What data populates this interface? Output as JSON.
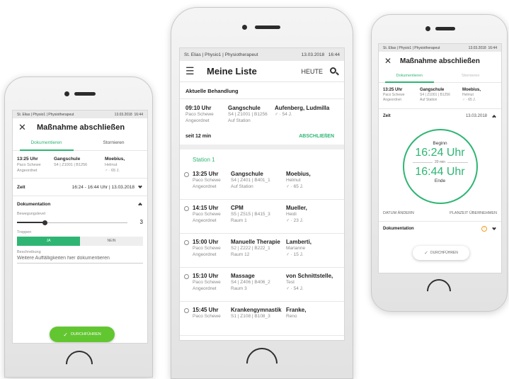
{
  "status": {
    "org": "St. Elias | Physio1 | Physiotherapeut",
    "date": "13.03.2018",
    "time": "16:44"
  },
  "left": {
    "title": "Maßnahme abschließen",
    "tabs": [
      "Dokumentieren",
      "Stornieren"
    ],
    "appointment": {
      "time": "13:25 Uhr",
      "therapist": "Paco Schewe",
      "status": "Angeordnet",
      "treatment": "Gangschule",
      "room_code": "S4 | Z1001 | B1256",
      "patient": "Moebius,",
      "first_name": "Helmut",
      "age": "♂ · 65 J."
    },
    "zeit_label": "Zeit",
    "zeit_value": "16:24 - 16:44 Uhr | 13.03.2018",
    "doc_label": "Dokumentation",
    "slider_label": "Bewegungslevel",
    "slider_value": "3",
    "slider_fraction": 0.25,
    "stairs_label": "Treppen",
    "stairs_yes": "JA",
    "stairs_no": "NEIN",
    "desc_label": "Beschreibung",
    "desc_placeholder": "Weitere Auffälligkeiten hier dokumentieren",
    "action": "DURCHFÜHREN"
  },
  "middle": {
    "title": "Meine Liste",
    "today": "HEUTE",
    "current_header": "Aktuelle Behandlung",
    "current": {
      "time": "09:10 Uhr",
      "therapist": "Paco Schewe",
      "status": "Angeordnet",
      "treatment": "Gangschule",
      "room_code": "S4 | Z1001 | B1256",
      "location": "Auf Station",
      "patient": "Aufenberg, Ludmilla",
      "age": "♂ · 54 J."
    },
    "since": "seit 12 min",
    "finish": "ABSCHLIEßEN",
    "station": "Station 1",
    "items": [
      {
        "time": "13:25 Uhr",
        "therapist": "Paco Schewe",
        "status": "Angeordnet",
        "treatment": "Gangschule",
        "room_code": "S4 | Z401 | B401_1",
        "location": "Auf Station",
        "patient": "Moebius,",
        "first_name": "Helmut",
        "age": "♂ · 65 J."
      },
      {
        "time": "14:15 Uhr",
        "therapist": "Paco Schewe",
        "status": "Angeordnet",
        "treatment": "CPM",
        "room_code": "S5 | Z515 | B415_3",
        "location": "Raum 1",
        "patient": "Mueller,",
        "first_name": "Heidi",
        "age": "♂ · 23 J."
      },
      {
        "time": "15:00 Uhr",
        "therapist": "Paco Schewe",
        "status": "Angeordnet",
        "treatment": "Manuelle Therapie",
        "room_code": "S2 | Z222 | B222_1",
        "location": "Raum 12",
        "patient": "Lamberti,",
        "first_name": "Marianne",
        "age": "♂ · 15 J."
      },
      {
        "time": "15:10 Uhr",
        "therapist": "Paco Schewe",
        "status": "Angeordnet",
        "treatment": "Massage",
        "room_code": "S4 | Z406 | B406_2",
        "location": "Raum 3",
        "patient": "von Schnittstelle,",
        "first_name": "Test",
        "age": "♂ · 54 J."
      },
      {
        "time": "15:45 Uhr",
        "therapist": "Paco Schewe",
        "status": "",
        "treatment": "Krankengymnastik",
        "room_code": "S1 | Z108 | B108_3",
        "location": "",
        "patient": "Franke,",
        "first_name": "Reno",
        "age": ""
      }
    ]
  },
  "right": {
    "title": "Maßnahme abschließen",
    "tabs": [
      "Dokumentieren",
      "Stornieren"
    ],
    "appointment": {
      "time": "13:25 Uhr",
      "therapist": "Paco Schewe",
      "status": "Angeordnet",
      "treatment": "Gangschule",
      "room_code": "S4 | Z1001 | B1256",
      "location": "Auf Station",
      "patient": "Moebius,",
      "first_name": "Helmut",
      "age": "♂ · 65 J."
    },
    "zeit_label": "Zeit",
    "zeit_date": "13.03.2018",
    "begin_label": "Beginn",
    "begin_time": "16:24 Uhr",
    "duration": "20 min",
    "end_time": "16:44 Uhr",
    "end_label": "Ende",
    "change_date": "DATUM ÄNDERN",
    "take_plan": "PLANZEIT ÜBERNEHMEN",
    "doc_label": "Dokumentation",
    "action": "DURCHFÜHREN"
  },
  "colors": {
    "accent": "#2eb573",
    "warning": "#f0a020"
  }
}
